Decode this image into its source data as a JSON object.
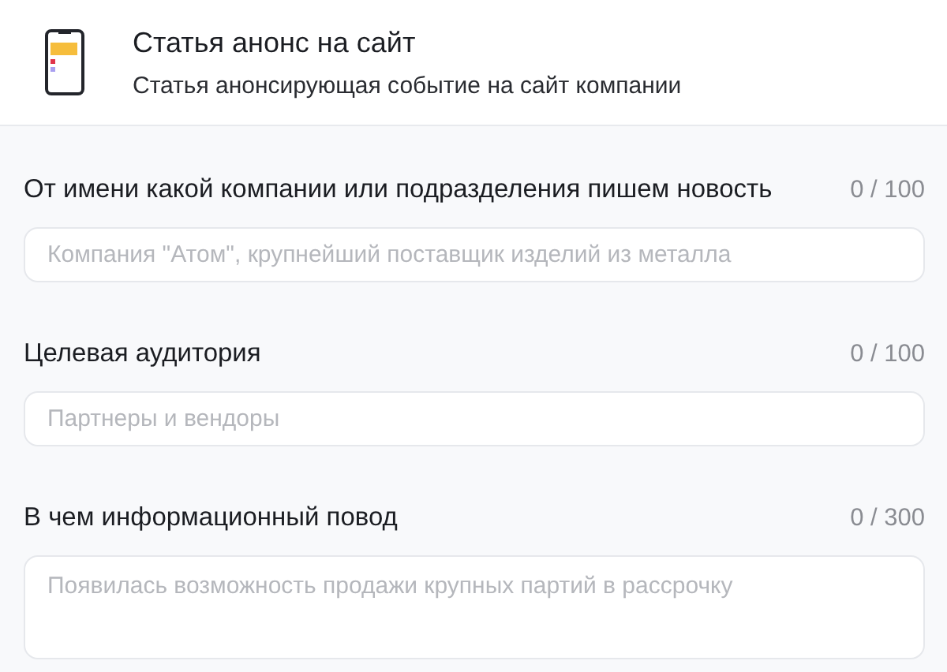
{
  "header": {
    "title": "Статья анонс на сайт",
    "subtitle": "Статья анонсирующая событие на сайт компании"
  },
  "fields": [
    {
      "kind": "input",
      "label": "От имени какой компании или подразделения пишем новость",
      "counter": "0 / 100",
      "placeholder": "Компания \"Атом\", крупнейший поставщик изделий из металла"
    },
    {
      "kind": "input",
      "label": "Целевая аудитория",
      "counter": "0 / 100",
      "placeholder": "Партнеры и вендоры"
    },
    {
      "kind": "textarea",
      "label": "В чем информационный повод",
      "counter": "0 / 300",
      "placeholder": "Появилась возможность продажи крупных партий в рассрочку"
    }
  ]
}
